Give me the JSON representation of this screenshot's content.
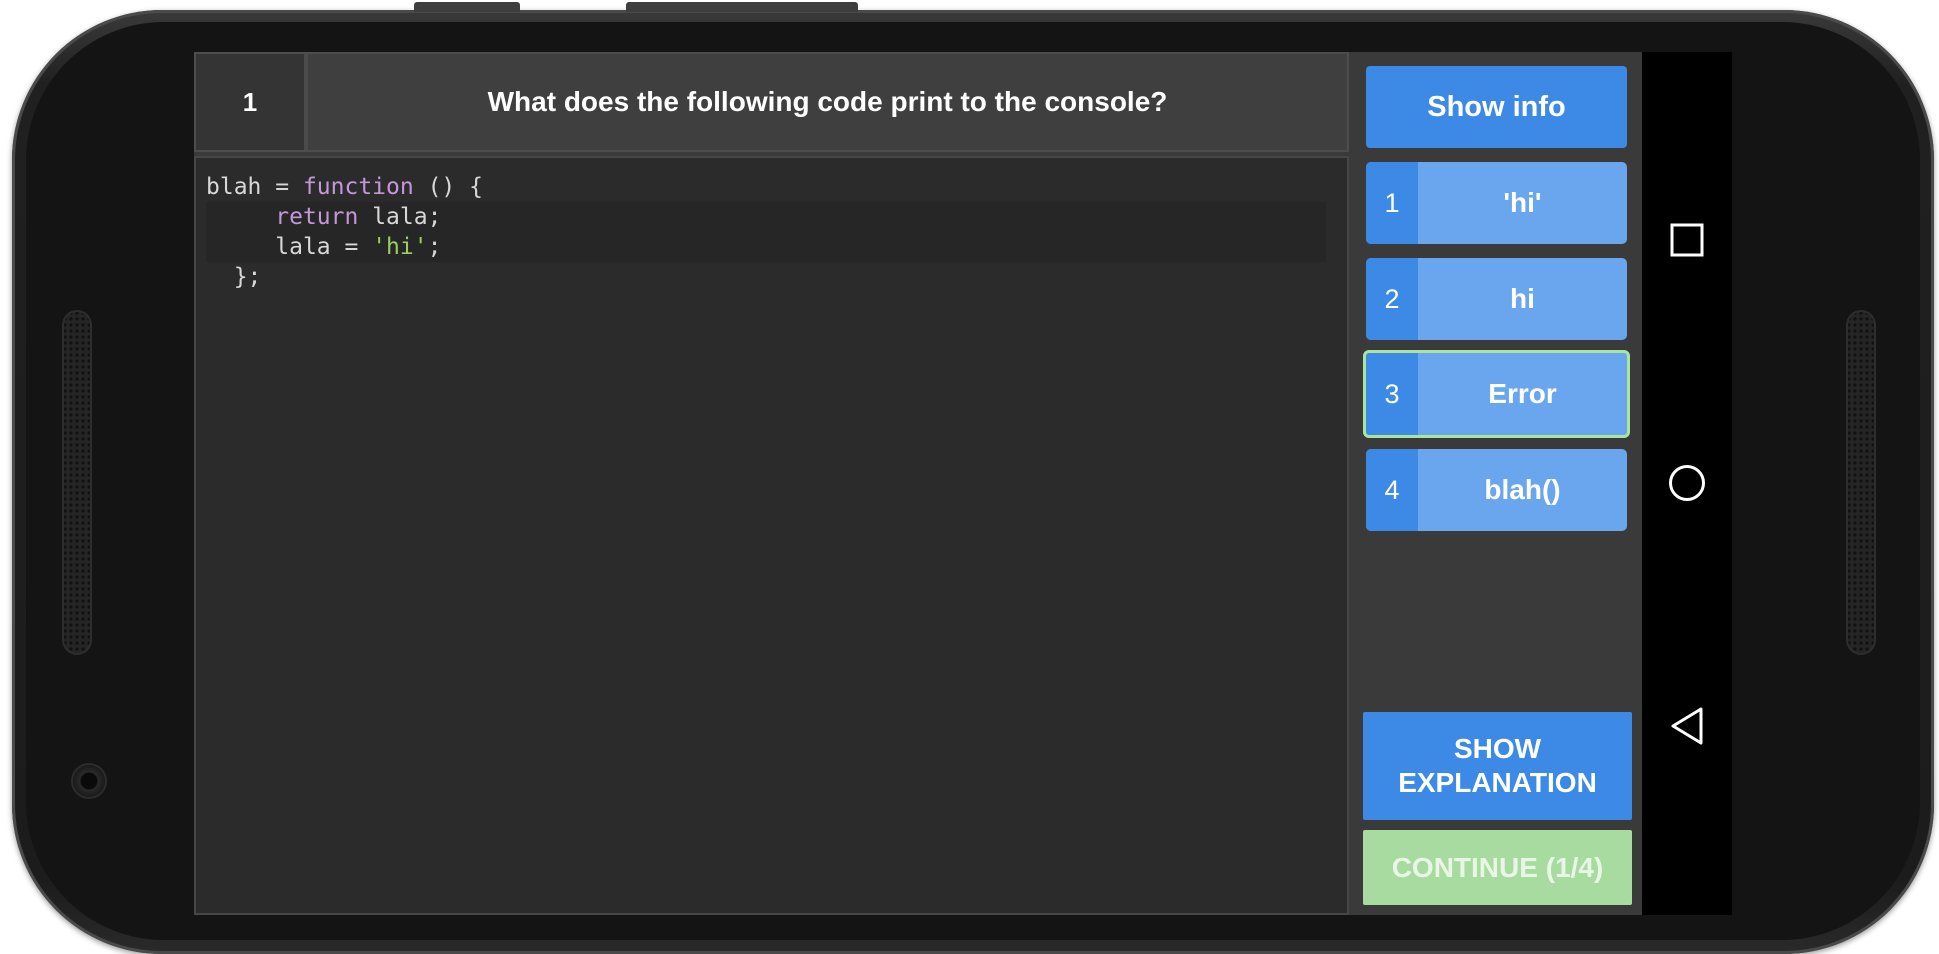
{
  "question": {
    "number": "1",
    "text": "What does the following code print to the console?"
  },
  "code": {
    "lines": [
      {
        "indent": "",
        "parts": [
          {
            "t": "blah = ",
            "c": "plain"
          },
          {
            "t": "function",
            "c": "kw"
          },
          {
            "t": " () {",
            "c": "plain"
          }
        ]
      },
      {
        "indent": "     ",
        "parts": [
          {
            "t": "return",
            "c": "kw"
          },
          {
            "t": " lala;",
            "c": "plain"
          }
        ]
      },
      {
        "indent": "     ",
        "parts": [
          {
            "t": "lala = ",
            "c": "plain"
          },
          {
            "t": "'hi'",
            "c": "str"
          },
          {
            "t": ";",
            "c": "plain"
          }
        ]
      },
      {
        "indent": "  ",
        "parts": [
          {
            "t": "};",
            "c": "plain"
          }
        ]
      }
    ]
  },
  "sidebar": {
    "show_info_label": "Show info",
    "answers": [
      {
        "num": "1",
        "label": "'hi'",
        "selected": false
      },
      {
        "num": "2",
        "label": "hi",
        "selected": false
      },
      {
        "num": "3",
        "label": "Error",
        "selected": true
      },
      {
        "num": "4",
        "label": "blah()",
        "selected": false
      }
    ],
    "show_explanation_label": "SHOW\nEXPLANATION",
    "continue_label": "CONTINUE (1/4)"
  },
  "navbar": {
    "icons": [
      "recent-apps-icon",
      "home-icon",
      "back-icon"
    ]
  },
  "colors": {
    "primary_blue": "#3d8ae6",
    "answer_blue": "#6aa6ee",
    "selected_border": "#a8e6a0",
    "continue_green": "#a7dba0",
    "keyword": "#c397d8",
    "string": "#9ccc65"
  }
}
